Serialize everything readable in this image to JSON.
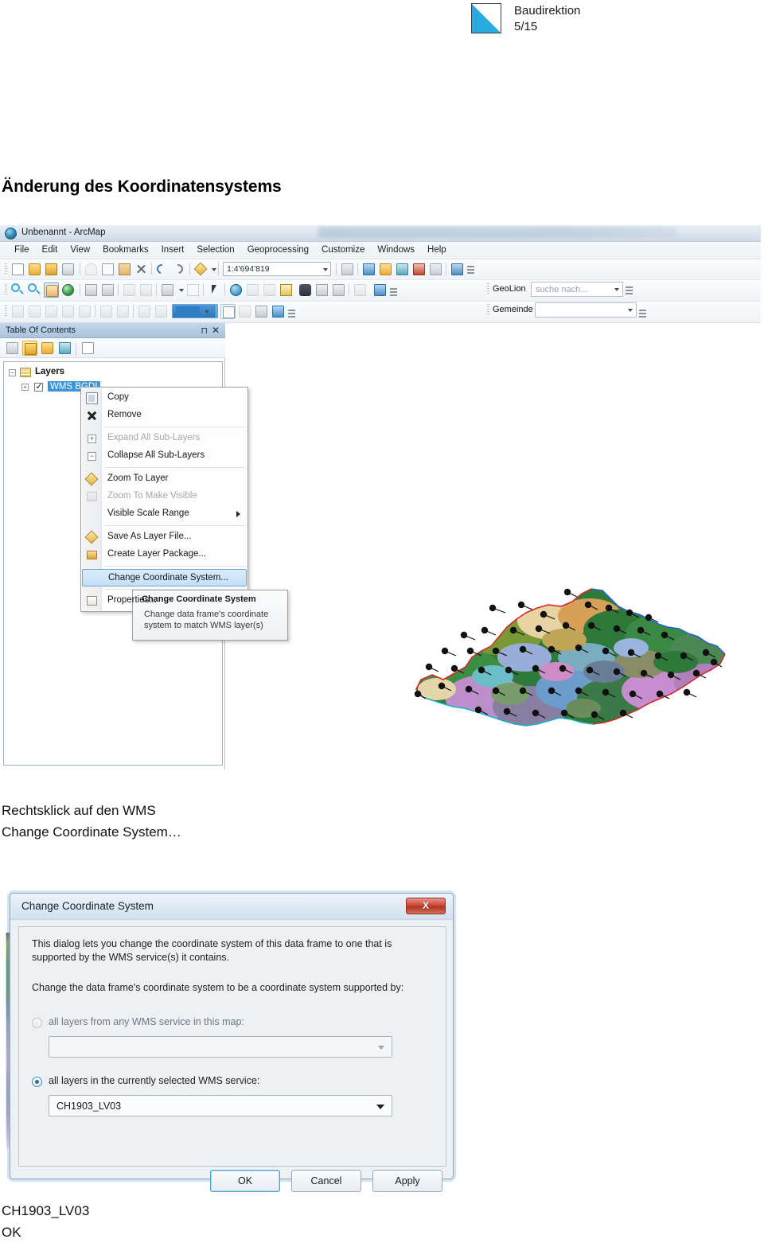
{
  "header": {
    "org": "Baudirektion",
    "page": "5/15",
    "logo": "baudirektion-logo"
  },
  "section_title": "Änderung des Koordinatensystems",
  "arcmap": {
    "window_title": "Unbenannt - ArcMap",
    "menu": [
      "File",
      "Edit",
      "View",
      "Bookmarks",
      "Insert",
      "Selection",
      "Geoprocessing",
      "Customize",
      "Windows",
      "Help"
    ],
    "scale": "1:4'694'819",
    "geolion": {
      "label": "GeoLion",
      "placeholder": "suche nach..."
    },
    "gemeinde": {
      "label": "Gemeinde",
      "value": ""
    },
    "toc": {
      "title": "Table Of Contents",
      "pin_icon": "pin-icon",
      "close_icon": "close-icon",
      "root": "Layers",
      "layer": "WMS BGDI"
    },
    "context_menu": [
      {
        "label": "Copy",
        "icon": "copy-icon",
        "state": "normal"
      },
      {
        "label": "Remove",
        "icon": "remove-icon",
        "state": "normal"
      },
      {
        "label": "Expand All Sub-Layers",
        "icon": "expand-icon",
        "state": "disabled"
      },
      {
        "label": "Collapse All Sub-Layers",
        "icon": "collapse-icon",
        "state": "normal"
      },
      {
        "label": "Zoom To Layer",
        "icon": "zoom-to-layer-icon",
        "state": "normal"
      },
      {
        "label": "Zoom To Make Visible",
        "icon": "zoom-visible-icon",
        "state": "disabled"
      },
      {
        "label": "Visible Scale Range",
        "icon": "none",
        "state": "submenu"
      },
      {
        "label": "Save As Layer File...",
        "icon": "layer-file-icon",
        "state": "normal"
      },
      {
        "label": "Create Layer Package...",
        "icon": "layer-package-icon",
        "state": "normal"
      },
      {
        "label": "Change Coordinate System...",
        "icon": "none",
        "state": "highlighted"
      },
      {
        "label": "Properties...",
        "icon": "properties-icon",
        "state": "normal"
      }
    ],
    "tooltip": {
      "title": "Change Coordinate System",
      "line1": "Change data frame's coordinate",
      "line2": "system to match WMS layer(s)"
    }
  },
  "caption_1": {
    "line1": "Rechtsklick auf den WMS",
    "line2": "Change Coordinate System…"
  },
  "dialog": {
    "title": "Change Coordinate System",
    "close_label": "X",
    "intro": "This dialog lets you change the coordinate system of this data frame to one that is supported by the WMS service(s) it contains.",
    "prompt": "Change the data frame's coordinate system to be a coordinate system supported by:",
    "option_any": {
      "label": "all layers from any WMS service in this map:",
      "selected": false,
      "value": ""
    },
    "option_selected": {
      "label": "all layers in the currently selected WMS service:",
      "selected": true,
      "value": "CH1903_LV03"
    },
    "buttons": {
      "ok": "OK",
      "cancel": "Cancel",
      "apply": "Apply"
    }
  },
  "caption_2": {
    "line1": "CH1903_LV03",
    "line2": "OK"
  },
  "colors": {
    "accent": "#29abe2",
    "highlight": "#3d95d6",
    "close_red": "#c94a36"
  }
}
